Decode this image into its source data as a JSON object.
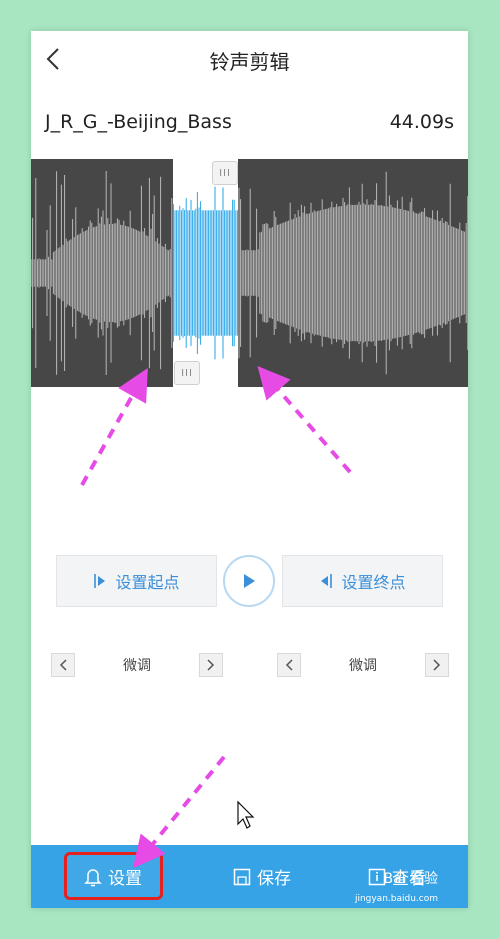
{
  "header": {
    "title": "铃声剪辑",
    "back_icon": "chevron-left-icon"
  },
  "song": {
    "name": "J_R_G_-Beijing_Bass",
    "duration": "44.09s"
  },
  "waveform": {
    "selection_start_fraction": 0.325,
    "selection_end_fraction": 0.474,
    "selected_color": "#2aa6e8",
    "unselected_color": "#b9b9b9",
    "background": "#474747"
  },
  "controls": {
    "set_start_label": "设置起点",
    "set_end_label": "设置终点",
    "play_icon": "play-icon"
  },
  "fine_tune": {
    "left_label": "微调",
    "right_label": "微调"
  },
  "bottom_bar": {
    "set_label": "设置",
    "save_label": "保存",
    "view_label": "查看",
    "set_icon": "bell-icon",
    "save_icon": "save-icon",
    "view_icon": "info-icon"
  },
  "watermark": {
    "text": "Bai 经验",
    "sub": "jingyan.baidu.com"
  },
  "colors": {
    "accent": "#36a3e6",
    "annotation_arrow": "#e64be6",
    "highlight_box": "#e61f1f",
    "page_bg": "#a8e6c2"
  }
}
